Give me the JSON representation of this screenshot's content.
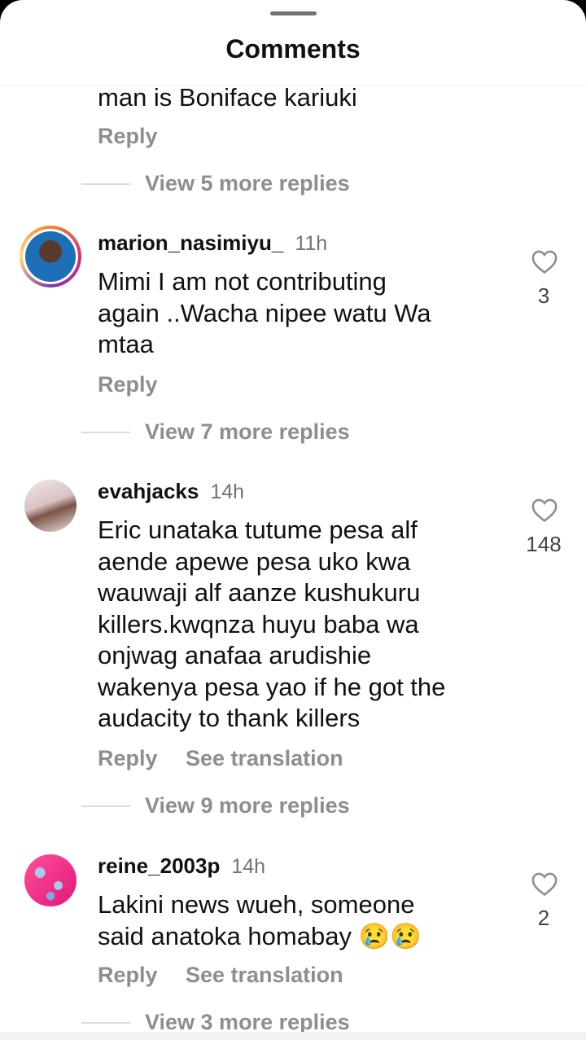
{
  "header": {
    "title": "Comments"
  },
  "comments": [
    {
      "text": "man is Boniface kariuki",
      "reply_label": "Reply",
      "view_replies": "View 5 more replies"
    },
    {
      "username": "marion_nasimiyu_",
      "time": "11h",
      "lines": [
        "Mimi I am not contributing",
        "again ..Wacha nipee watu Wa",
        "mtaa"
      ],
      "likes": "3",
      "reply_label": "Reply",
      "view_replies": "View 7 more replies"
    },
    {
      "username": "evahjacks",
      "time": "14h",
      "lines": [
        "Eric unataka tutume pesa alf",
        "aende apewe pesa uko kwa",
        "wauwaji alf aanze kushukuru",
        "killers.kwqnza huyu baba wa",
        "onjwag anafaa arudishie",
        "wakenya pesa yao if he got the",
        "audacity to thank killers"
      ],
      "likes": "148",
      "reply_label": "Reply",
      "translation_label": "See translation",
      "view_replies": "View 9 more replies"
    },
    {
      "username": "reine_2003p",
      "time": "14h",
      "lines": [
        "Lakini news wueh, someone",
        "said anatoka homabay 😢😢"
      ],
      "likes": "2",
      "reply_label": "Reply",
      "translation_label": "See translation",
      "view_replies": "View 3 more replies"
    }
  ],
  "colors": {
    "text": "#111111",
    "secondary": "#8e8e8e",
    "divider": "#dbdbdb"
  },
  "icons": {
    "like": "heart-outline-icon"
  }
}
